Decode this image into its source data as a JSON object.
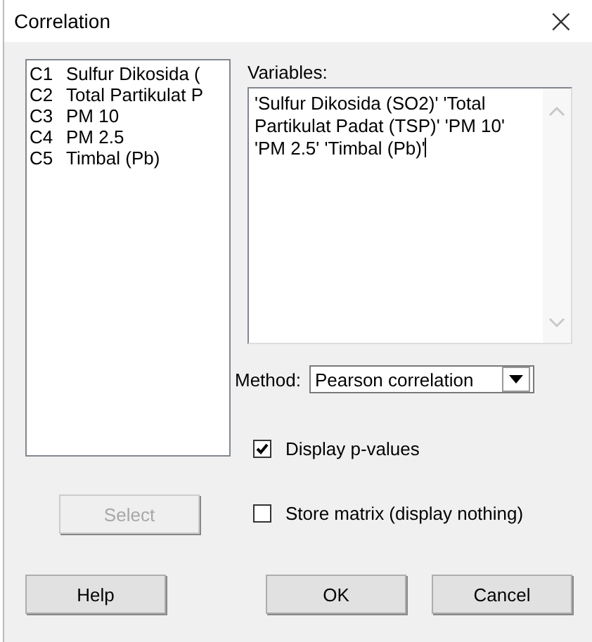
{
  "window": {
    "title": "Correlation",
    "close": "×"
  },
  "columns": [
    {
      "id": "C1",
      "name": "Sulfur Dikosida ("
    },
    {
      "id": "C2",
      "name": "Total Partikulat P"
    },
    {
      "id": "C3",
      "name": "PM 10"
    },
    {
      "id": "C4",
      "name": "PM 2.5"
    },
    {
      "id": "C5",
      "name": "Timbal (Pb)"
    }
  ],
  "variables": {
    "label": "Variables:",
    "value": "'Sulfur Dikosida (SO2)' 'Total Partikulat Padat (TSP)' 'PM 10' 'PM 2.5' 'Timbal (Pb)'"
  },
  "method": {
    "label": "Method:",
    "value": "Pearson correlation"
  },
  "options": [
    {
      "label": "Display p-values",
      "checked": true
    },
    {
      "label": "Store matrix (display nothing)",
      "checked": false
    }
  ],
  "select_button": {
    "label": "Select",
    "disabled": true
  },
  "buttons": [
    "Help",
    "OK",
    "Cancel"
  ]
}
